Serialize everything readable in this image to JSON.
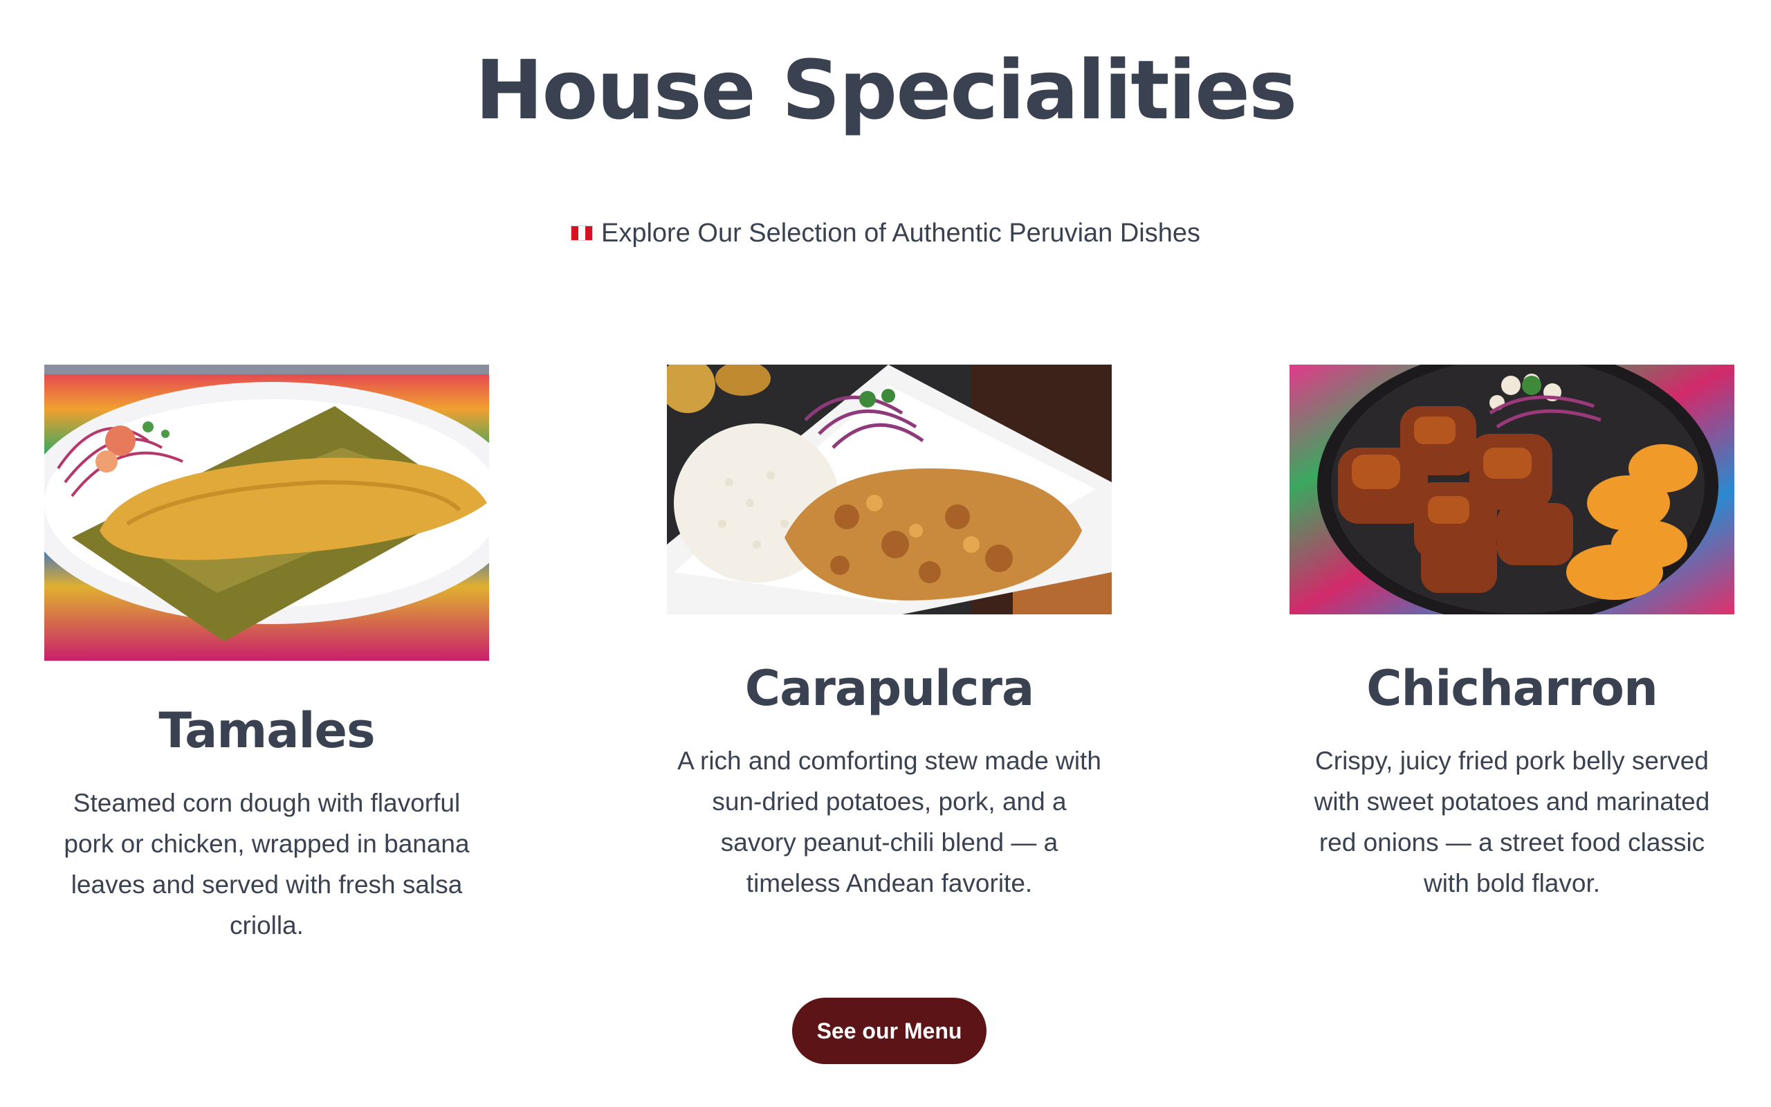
{
  "header": {
    "title": "House Specialities",
    "subtitle": "Explore Our Selection of Authentic Peruvian Dishes",
    "flag_icon": "peru-flag-icon"
  },
  "dishes": [
    {
      "name": "Tamales",
      "description": "Steamed corn dough with flavorful pork or chicken, wrapped in banana leaves and served with fresh salsa criolla."
    },
    {
      "name": "Carapulcra",
      "description": "A rich and comforting stew made with sun-dried potatoes, pork, and a savory peanut-chili blend — a timeless Andean favorite."
    },
    {
      "name": "Chicharron",
      "description": "Crispy, juicy fried pork belly served with sweet potatoes and marinated red onions — a street food classic with bold flavor."
    }
  ],
  "cta": {
    "label": "See our Menu"
  },
  "colors": {
    "text": "#3a4252",
    "button_bg": "#5c1416",
    "button_text": "#ffffff",
    "background": "#ffffff"
  }
}
